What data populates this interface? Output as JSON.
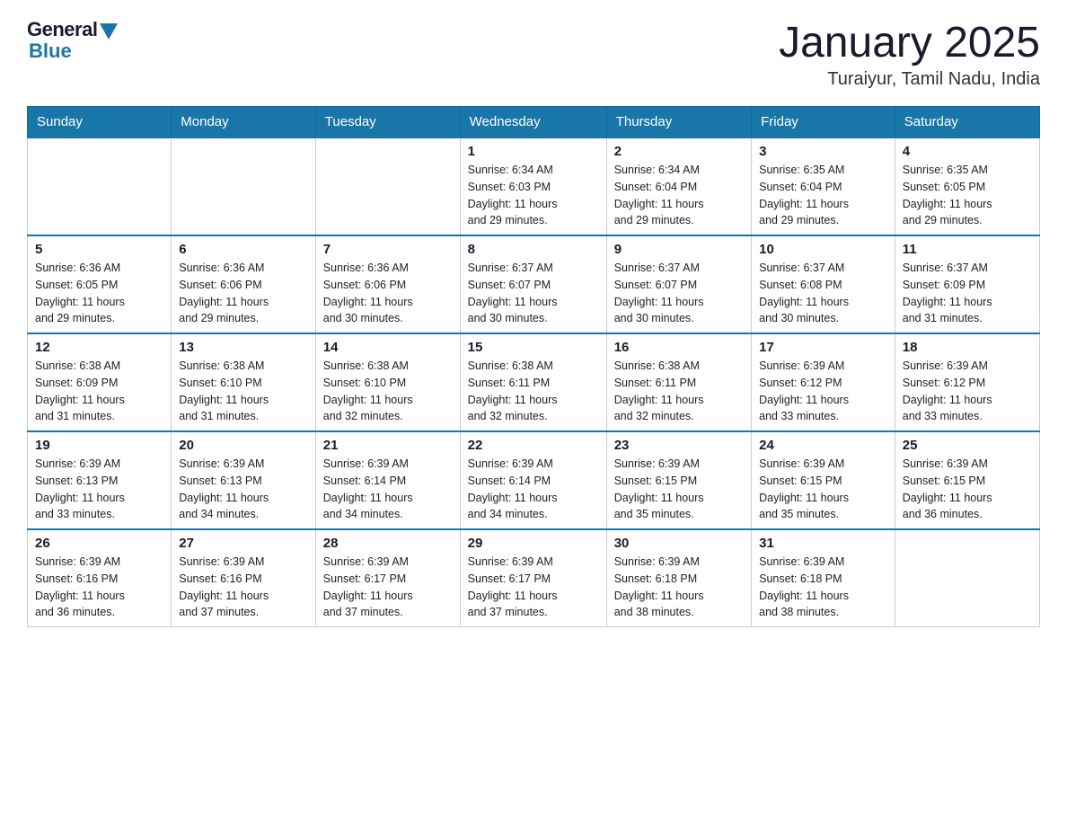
{
  "header": {
    "logo_general": "General",
    "logo_blue": "Blue",
    "main_title": "January 2025",
    "subtitle": "Turaiyur, Tamil Nadu, India"
  },
  "columns": [
    "Sunday",
    "Monday",
    "Tuesday",
    "Wednesday",
    "Thursday",
    "Friday",
    "Saturday"
  ],
  "weeks": [
    [
      {
        "day": "",
        "info": ""
      },
      {
        "day": "",
        "info": ""
      },
      {
        "day": "",
        "info": ""
      },
      {
        "day": "1",
        "info": "Sunrise: 6:34 AM\nSunset: 6:03 PM\nDaylight: 11 hours\nand 29 minutes."
      },
      {
        "day": "2",
        "info": "Sunrise: 6:34 AM\nSunset: 6:04 PM\nDaylight: 11 hours\nand 29 minutes."
      },
      {
        "day": "3",
        "info": "Sunrise: 6:35 AM\nSunset: 6:04 PM\nDaylight: 11 hours\nand 29 minutes."
      },
      {
        "day": "4",
        "info": "Sunrise: 6:35 AM\nSunset: 6:05 PM\nDaylight: 11 hours\nand 29 minutes."
      }
    ],
    [
      {
        "day": "5",
        "info": "Sunrise: 6:36 AM\nSunset: 6:05 PM\nDaylight: 11 hours\nand 29 minutes."
      },
      {
        "day": "6",
        "info": "Sunrise: 6:36 AM\nSunset: 6:06 PM\nDaylight: 11 hours\nand 29 minutes."
      },
      {
        "day": "7",
        "info": "Sunrise: 6:36 AM\nSunset: 6:06 PM\nDaylight: 11 hours\nand 30 minutes."
      },
      {
        "day": "8",
        "info": "Sunrise: 6:37 AM\nSunset: 6:07 PM\nDaylight: 11 hours\nand 30 minutes."
      },
      {
        "day": "9",
        "info": "Sunrise: 6:37 AM\nSunset: 6:07 PM\nDaylight: 11 hours\nand 30 minutes."
      },
      {
        "day": "10",
        "info": "Sunrise: 6:37 AM\nSunset: 6:08 PM\nDaylight: 11 hours\nand 30 minutes."
      },
      {
        "day": "11",
        "info": "Sunrise: 6:37 AM\nSunset: 6:09 PM\nDaylight: 11 hours\nand 31 minutes."
      }
    ],
    [
      {
        "day": "12",
        "info": "Sunrise: 6:38 AM\nSunset: 6:09 PM\nDaylight: 11 hours\nand 31 minutes."
      },
      {
        "day": "13",
        "info": "Sunrise: 6:38 AM\nSunset: 6:10 PM\nDaylight: 11 hours\nand 31 minutes."
      },
      {
        "day": "14",
        "info": "Sunrise: 6:38 AM\nSunset: 6:10 PM\nDaylight: 11 hours\nand 32 minutes."
      },
      {
        "day": "15",
        "info": "Sunrise: 6:38 AM\nSunset: 6:11 PM\nDaylight: 11 hours\nand 32 minutes."
      },
      {
        "day": "16",
        "info": "Sunrise: 6:38 AM\nSunset: 6:11 PM\nDaylight: 11 hours\nand 32 minutes."
      },
      {
        "day": "17",
        "info": "Sunrise: 6:39 AM\nSunset: 6:12 PM\nDaylight: 11 hours\nand 33 minutes."
      },
      {
        "day": "18",
        "info": "Sunrise: 6:39 AM\nSunset: 6:12 PM\nDaylight: 11 hours\nand 33 minutes."
      }
    ],
    [
      {
        "day": "19",
        "info": "Sunrise: 6:39 AM\nSunset: 6:13 PM\nDaylight: 11 hours\nand 33 minutes."
      },
      {
        "day": "20",
        "info": "Sunrise: 6:39 AM\nSunset: 6:13 PM\nDaylight: 11 hours\nand 34 minutes."
      },
      {
        "day": "21",
        "info": "Sunrise: 6:39 AM\nSunset: 6:14 PM\nDaylight: 11 hours\nand 34 minutes."
      },
      {
        "day": "22",
        "info": "Sunrise: 6:39 AM\nSunset: 6:14 PM\nDaylight: 11 hours\nand 34 minutes."
      },
      {
        "day": "23",
        "info": "Sunrise: 6:39 AM\nSunset: 6:15 PM\nDaylight: 11 hours\nand 35 minutes."
      },
      {
        "day": "24",
        "info": "Sunrise: 6:39 AM\nSunset: 6:15 PM\nDaylight: 11 hours\nand 35 minutes."
      },
      {
        "day": "25",
        "info": "Sunrise: 6:39 AM\nSunset: 6:15 PM\nDaylight: 11 hours\nand 36 minutes."
      }
    ],
    [
      {
        "day": "26",
        "info": "Sunrise: 6:39 AM\nSunset: 6:16 PM\nDaylight: 11 hours\nand 36 minutes."
      },
      {
        "day": "27",
        "info": "Sunrise: 6:39 AM\nSunset: 6:16 PM\nDaylight: 11 hours\nand 37 minutes."
      },
      {
        "day": "28",
        "info": "Sunrise: 6:39 AM\nSunset: 6:17 PM\nDaylight: 11 hours\nand 37 minutes."
      },
      {
        "day": "29",
        "info": "Sunrise: 6:39 AM\nSunset: 6:17 PM\nDaylight: 11 hours\nand 37 minutes."
      },
      {
        "day": "30",
        "info": "Sunrise: 6:39 AM\nSunset: 6:18 PM\nDaylight: 11 hours\nand 38 minutes."
      },
      {
        "day": "31",
        "info": "Sunrise: 6:39 AM\nSunset: 6:18 PM\nDaylight: 11 hours\nand 38 minutes."
      },
      {
        "day": "",
        "info": ""
      }
    ]
  ]
}
